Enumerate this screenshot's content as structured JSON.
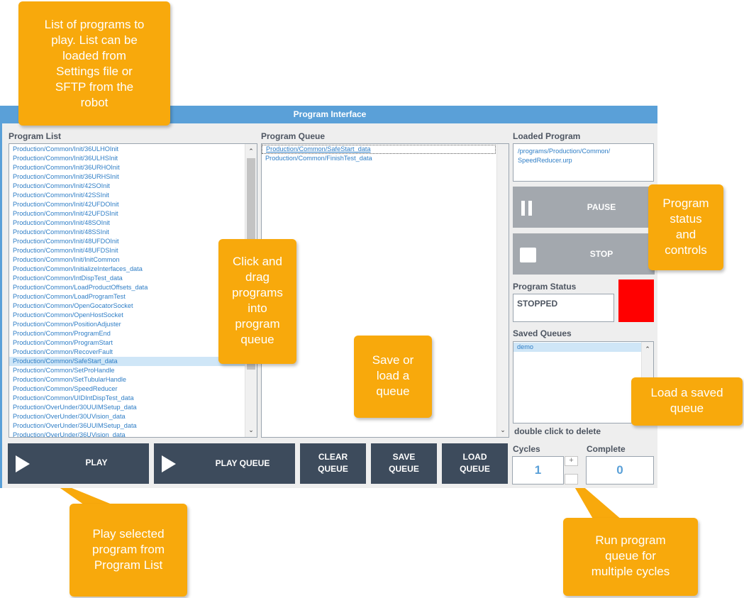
{
  "window": {
    "title": "Program Interface"
  },
  "program_list": {
    "label": "Program List",
    "items": [
      "Production/Common/Init/36ULHOInit",
      "Production/Common/Init/36ULHSInit",
      "Production/Common/Init/36URHOInit",
      "Production/Common/Init/36URHSInit",
      "Production/Common/Init/42SOInit",
      "Production/Common/Init/42SSInit",
      "Production/Common/Init/42UFDOInit",
      "Production/Common/Init/42UFDSInit",
      "Production/Common/Init/48SOInit",
      "Production/Common/Init/48SSInit",
      "Production/Common/Init/48UFDOInit",
      "Production/Common/Init/48UFDSInit",
      "Production/Common/Init/InitCommon",
      "Production/Common/InitializeInterfaces_data",
      "Production/Common/IntDispTest_data",
      "Production/Common/LoadProductOffsets_data",
      "Production/Common/LoadProgramTest",
      "Production/Common/OpenGocatorSocket",
      "Production/Common/OpenHostSocket",
      "Production/Common/PositionAdjuster",
      "Production/Common/ProgramEnd",
      "Production/Common/ProgramStart",
      "Production/Common/RecoverFault",
      "Production/Common/SafeStart_data",
      "Production/Common/SetProHandle",
      "Production/Common/SetTubularHandle",
      "Production/Common/SpeedReducer",
      "Production/Common/UIDIntDispTest_data",
      "Production/OverUnder/30UUIMSetup_data",
      "Production/OverUnder/30UVision_data",
      "Production/OverUnder/36UUIMSetup_data",
      "Production/OverUnder/36UVision_data"
    ]
  },
  "program_queue": {
    "label": "Program Queue",
    "items": [
      "Production/Common/SafeStart_data",
      "Production/Common/FinishTest_data"
    ]
  },
  "loaded_program": {
    "label": "Loaded Program",
    "line1": "/programs/Production/Common/",
    "line2": "SpeedReducer.urp"
  },
  "controls": {
    "pause_label": "PAUSE",
    "stop_label": "STOP"
  },
  "program_status": {
    "label": "Program Status",
    "value": "STOPPED",
    "indicator_color": "#ff0000"
  },
  "saved_queues": {
    "label": "Saved Queues",
    "items": [
      "demo"
    ],
    "hint": "double click to delete"
  },
  "buttons": {
    "play": "PLAY",
    "play_queue": "PLAY QUEUE",
    "clear_queue_1": "CLEAR",
    "clear_queue_2": "QUEUE",
    "save_queue_1": "SAVE",
    "save_queue_2": "QUEUE",
    "load_queue_1": "LOAD",
    "load_queue_2": "QUEUE"
  },
  "cycles": {
    "label": "Cycles",
    "value": "1",
    "plus": "+"
  },
  "complete": {
    "label": "Complete",
    "value": "0"
  },
  "callouts": {
    "program_list": [
      "List of programs to",
      "play. List can be",
      "loaded from",
      "Settings file or",
      "SFTP from the",
      "robot"
    ],
    "drag": [
      "Click and",
      "drag",
      "programs",
      "into",
      "program",
      "queue"
    ],
    "save_load": [
      "Save or",
      "load a",
      "queue"
    ],
    "status": [
      "Program",
      "status",
      "and",
      "controls"
    ],
    "saved": [
      "Load a saved",
      "queue"
    ],
    "play": [
      "Play selected",
      "program from",
      "Program List"
    ],
    "cycles": [
      "Run program",
      "queue for",
      "multiple cycles"
    ]
  },
  "colors": {
    "title_bar": "#5aa0d8",
    "dark_button": "#3d4b5c",
    "gray_button": "#a3a8ae",
    "item_text": "#2f7ec6",
    "callout": "#f8a90c"
  }
}
